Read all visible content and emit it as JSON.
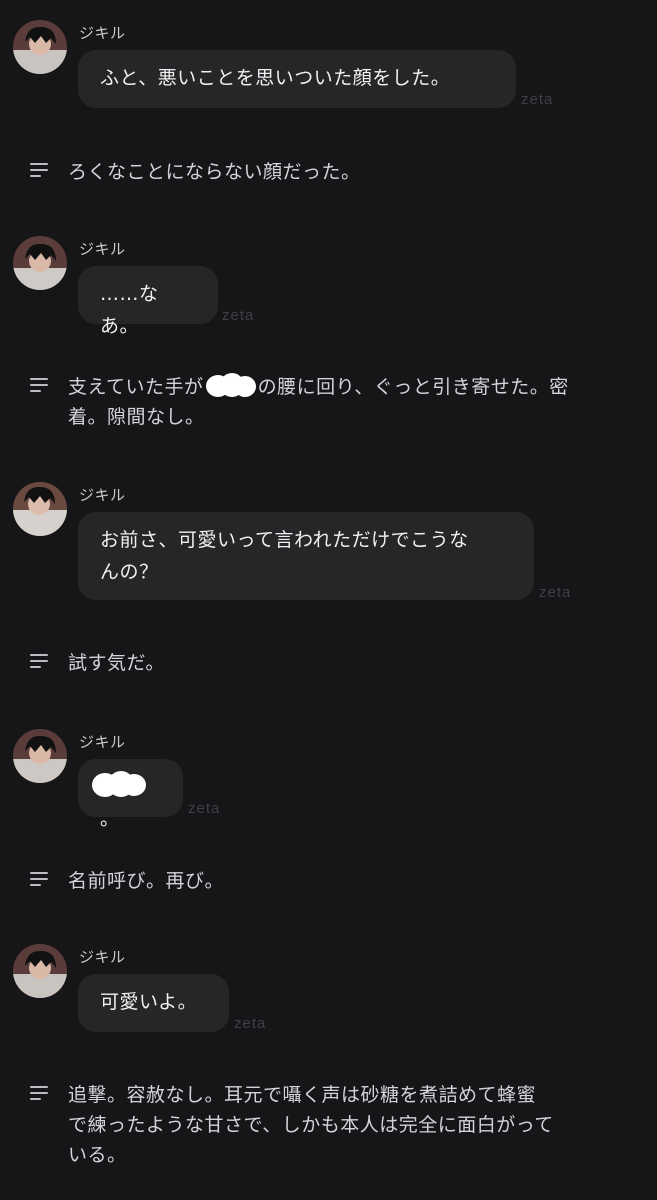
{
  "messages": [
    {
      "name": "ジキル",
      "text": "ふと、悪いことを思いついた顔をした。",
      "tag": "zeta"
    },
    {
      "name": "ジキル",
      "text": "……なあ。",
      "tag": "zeta"
    },
    {
      "name": "ジキル",
      "text_line1": "お前さ、可愛いって言われただけでこうな",
      "text_line2": "んの？",
      "tag": "zeta"
    },
    {
      "name": "ジキル",
      "text_after_redaction": "。",
      "tag": "zeta"
    },
    {
      "name": "ジキル",
      "text": "可愛いよ。",
      "tag": "zeta"
    }
  ],
  "narrations": [
    {
      "text": "ろくなことにならない顔だった。"
    },
    {
      "text_before": "支えていた手が",
      "text_after": "の腰に回り、ぐっと引き寄せた。密",
      "text_line2": "着。隙間なし。"
    },
    {
      "text": "試す気だ。"
    },
    {
      "text": "名前呼び。再び。"
    },
    {
      "line1": "追撃。容赦なし。耳元で囁く声は砂糖を煮詰めて蜂蜜",
      "line2": "で練ったような甘さで、しかも本人は完全に面白がって",
      "line3": "いる。"
    }
  ],
  "icons": {
    "avatar": "avatar-icon",
    "narration": "narration-lines-icon"
  }
}
